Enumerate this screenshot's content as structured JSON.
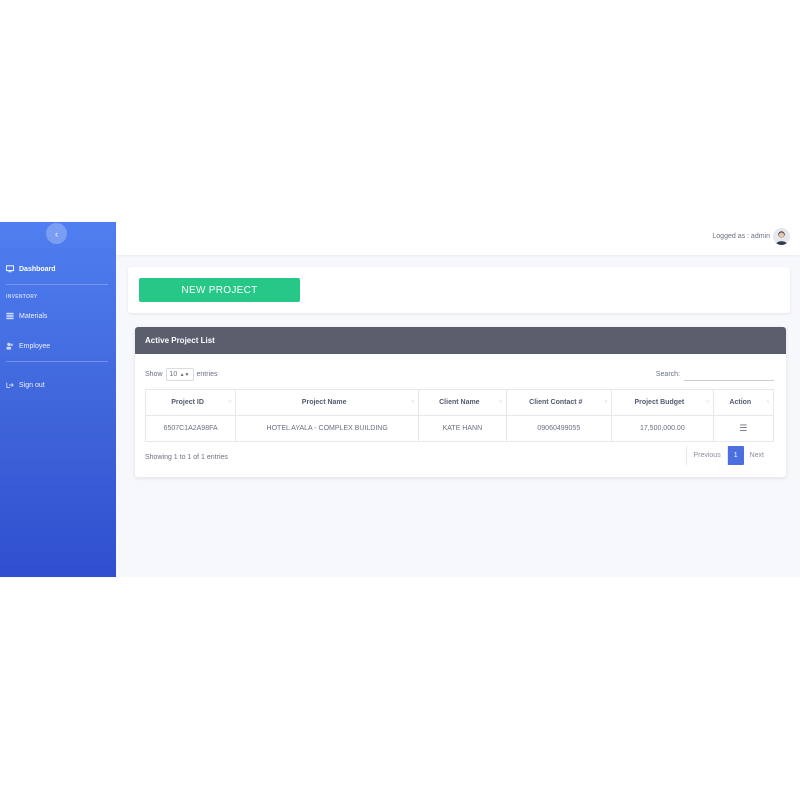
{
  "sidebar": {
    "toggle_icon": "chevron-left-icon",
    "items": [
      {
        "label": "Dashboard",
        "icon": "monitor-icon"
      },
      {
        "label": "Materials",
        "icon": "list-icon"
      },
      {
        "label": "Employee",
        "icon": "users-icon"
      },
      {
        "label": "Sign out",
        "icon": "sign-out-icon"
      }
    ],
    "section_inventory": "INVENTORY"
  },
  "topbar": {
    "logged_as": "Logged as : admin",
    "avatar_icon": "user-avatar-icon"
  },
  "actions": {
    "new_project_label": "NEW PROJECT"
  },
  "list": {
    "title": "Active Project List",
    "show_label": "Show",
    "entries_value": "10",
    "entries_label": "entries",
    "search_label": "Search:",
    "search_value": "",
    "columns": [
      "Project ID",
      "Project Name",
      "Client Name",
      "Client Contact #",
      "Project Budget",
      "Action"
    ],
    "rows": [
      {
        "id": "6507C1A2A98FA",
        "name": "HOTEL AYALA - COMPLEX BUILDING",
        "client": "KATE HANN",
        "contact": "09060499055",
        "budget": "17,500,000.00",
        "action_icon": "menu-icon"
      }
    ],
    "info": "Showing 1 to 1 of 1 entries",
    "pagination": {
      "previous": "Previous",
      "current": "1",
      "next": "Next"
    }
  },
  "colors": {
    "sidebar_top": "#4f7ff0",
    "sidebar_bottom": "#2f4fd0",
    "new_project_button": "#26c787",
    "card_header": "#5b5e6d",
    "page_active": "#4b6fe0"
  }
}
